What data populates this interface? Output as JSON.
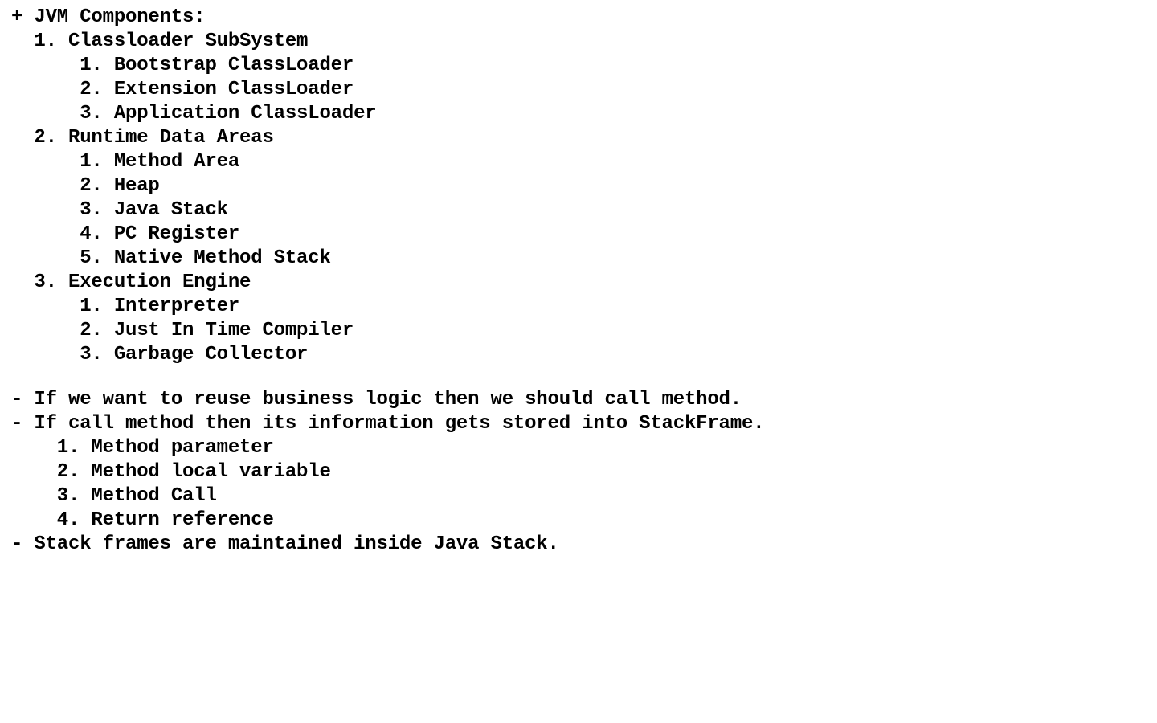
{
  "document": {
    "lines": [
      "+ JVM Components:",
      "  1. Classloader SubSystem",
      "      1. Bootstrap ClassLoader",
      "      2. Extension ClassLoader",
      "      3. Application ClassLoader",
      "  2. Runtime Data Areas",
      "      1. Method Area",
      "      2. Heap",
      "      3. Java Stack",
      "      4. PC Register",
      "      5. Native Method Stack",
      "  3. Execution Engine",
      "      1. Interpreter",
      "      2. Just In Time Compiler",
      "      3. Garbage Collector",
      "",
      "- If we want to reuse business logic then we should call method.",
      "- If call method then its information gets stored into StackFrame.",
      "    1. Method parameter",
      "    2. Method local variable",
      "    3. Method Call",
      "    4. Return reference",
      "- Stack frames are maintained inside Java Stack."
    ]
  }
}
